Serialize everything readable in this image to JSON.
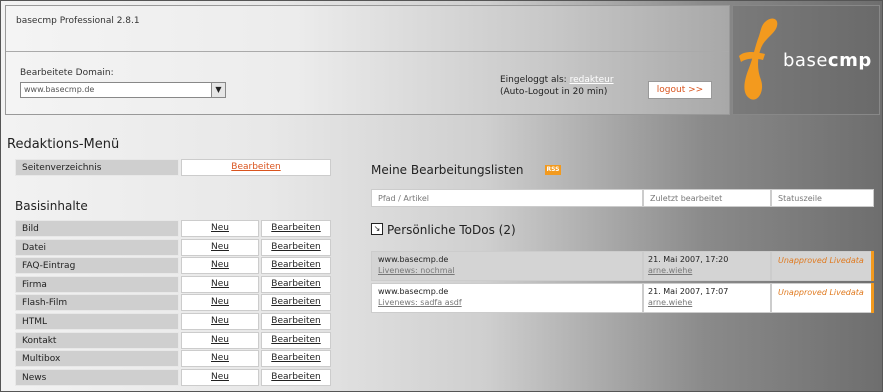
{
  "header": {
    "app_title": "basecmp Professional 2.8.1",
    "domain_label": "Bearbeitete Domain:",
    "domain_value": "www.basecmp.de",
    "logged_in_prefix": "Eingeloggt als:",
    "logged_in_user": "redakteur",
    "auto_logout": "(Auto-Logout in 20 min)",
    "logout_label": "logout >>"
  },
  "logo": {
    "text_light": "base",
    "text_bold": "cmp",
    "brand_color": "#f39a1e"
  },
  "menu": {
    "title": "Redaktions-Menü",
    "seiten_label": "Seitenverzeichnis",
    "seiten_action": "Bearbeiten",
    "basis_title": "Basisinhalte",
    "new_label": "Neu",
    "edit_label": "Bearbeiten",
    "items": [
      "Bild",
      "Datei",
      "FAQ-Eintrag",
      "Firma",
      "Flash-Film",
      "HTML",
      "Kontakt",
      "Multibox",
      "News"
    ]
  },
  "lists": {
    "title": "Meine Bearbeitungslisten",
    "rss_label": "RSS",
    "columns": [
      "Pfad / Artikel",
      "Zuletzt bearbeitet",
      "Statuszeile"
    ]
  },
  "todos": {
    "title": "Persönliche ToDos (2)",
    "rows": [
      {
        "domain": "www.basecmp.de",
        "article": "Livenews: nochmal",
        "date": "21. Mai 2007, 17:20",
        "user": "arne.wiehe",
        "status": "Unapproved Livedata"
      },
      {
        "domain": "www.basecmp.de",
        "article": "Livenews: sadfa asdf",
        "date": "21. Mai 2007, 17:07",
        "user": "arne.wiehe",
        "status": "Unapproved Livedata"
      }
    ]
  }
}
